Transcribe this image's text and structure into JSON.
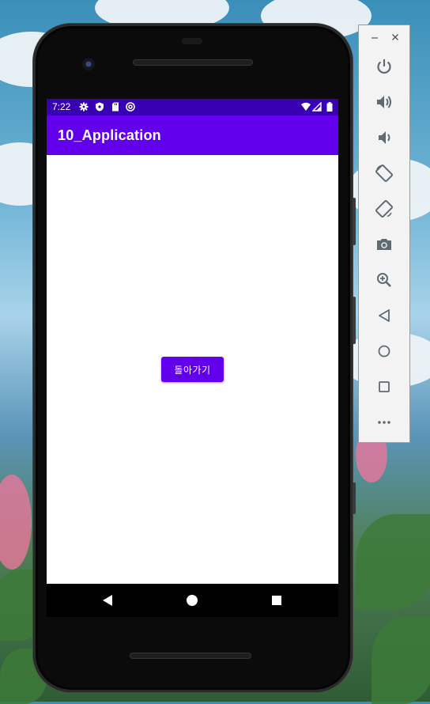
{
  "status_bar": {
    "time": "7:22",
    "left_icons": [
      "gear-icon",
      "shield-icon",
      "sd-card-icon",
      "at-sign-icon"
    ],
    "right_icons": [
      "wifi-icon",
      "signal-icon",
      "battery-icon"
    ],
    "color": "#3700b3"
  },
  "app_bar": {
    "title": "10_Application",
    "color": "#6200ee"
  },
  "content": {
    "button_label": "돌아가기"
  },
  "nav_bar": {
    "buttons": [
      "back-triangle-icon",
      "home-circle-icon",
      "recents-square-icon"
    ]
  },
  "emulator_toolbar": {
    "window_controls": [
      "minimize-icon",
      "close-icon"
    ],
    "buttons": [
      "power-icon",
      "volume-up-icon",
      "volume-down-icon",
      "rotate-left-icon",
      "rotate-right-icon",
      "camera-icon",
      "zoom-icon",
      "back-icon",
      "home-icon",
      "overview-icon",
      "more-icon"
    ]
  }
}
